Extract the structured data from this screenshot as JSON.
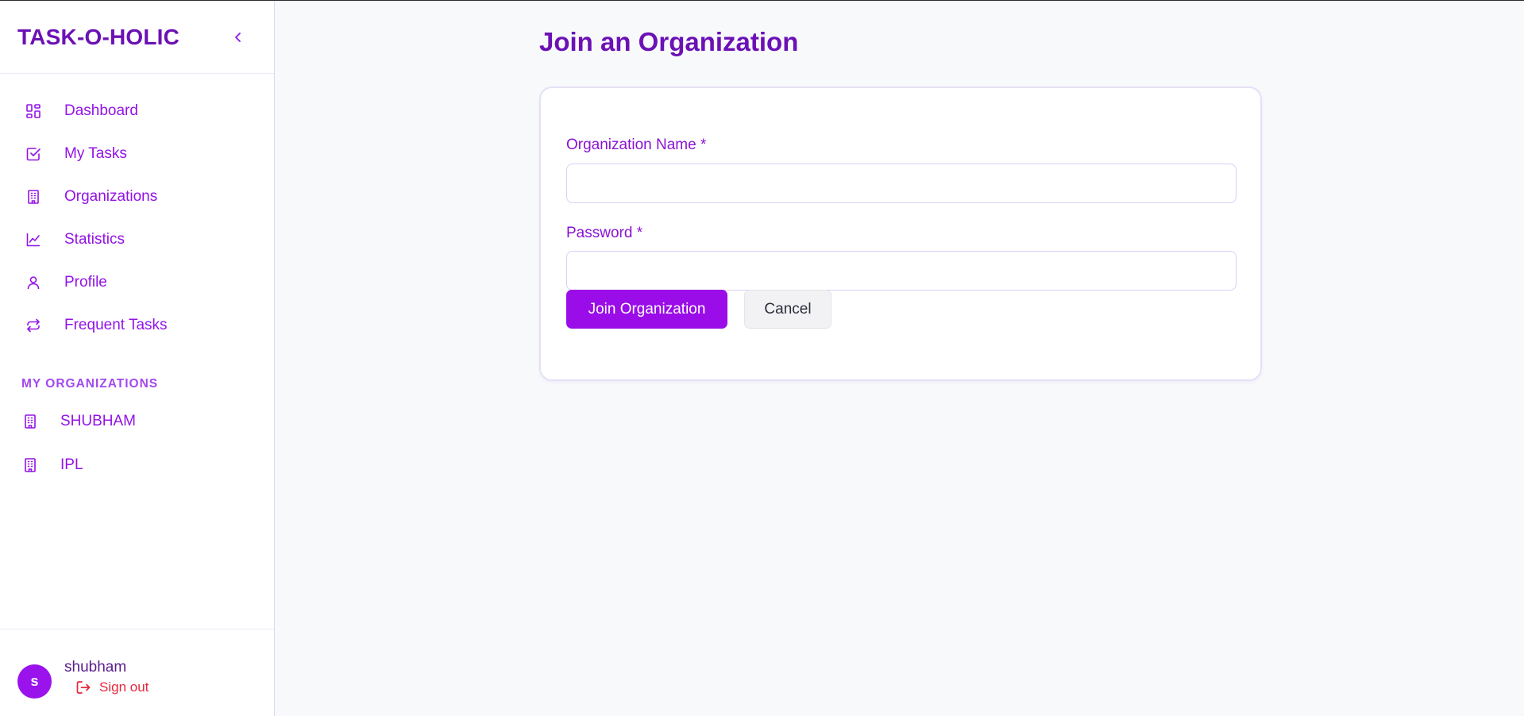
{
  "app": {
    "brand": "TASK-O-HOLIC"
  },
  "colors": {
    "accent": "#9a0de8",
    "title": "#6b11b5",
    "danger": "#e5283c"
  },
  "sidebar": {
    "collapse_icon": "chevron-left-icon",
    "nav": [
      {
        "label": "Dashboard",
        "icon": "dashboard-grid-icon"
      },
      {
        "label": "My Tasks",
        "icon": "checkbox-icon"
      },
      {
        "label": "Organizations",
        "icon": "building-icon"
      },
      {
        "label": "Statistics",
        "icon": "line-chart-icon"
      },
      {
        "label": "Profile",
        "icon": "user-icon"
      },
      {
        "label": "Frequent Tasks",
        "icon": "repeat-icon"
      }
    ],
    "orgs_section_title": "MY ORGANIZATIONS",
    "orgs": [
      {
        "label": "SHUBHAM",
        "icon": "building-icon"
      },
      {
        "label": "IPL",
        "icon": "building-icon"
      }
    ],
    "user": {
      "avatar_letter": "s",
      "name": "shubham",
      "signout_label": "Sign out"
    }
  },
  "main": {
    "title": "Join an Organization",
    "form": {
      "org_name_label": "Organization Name *",
      "org_name_value": "",
      "password_label": "Password *",
      "password_value": "",
      "submit_label": "Join Organization",
      "cancel_label": "Cancel"
    }
  }
}
